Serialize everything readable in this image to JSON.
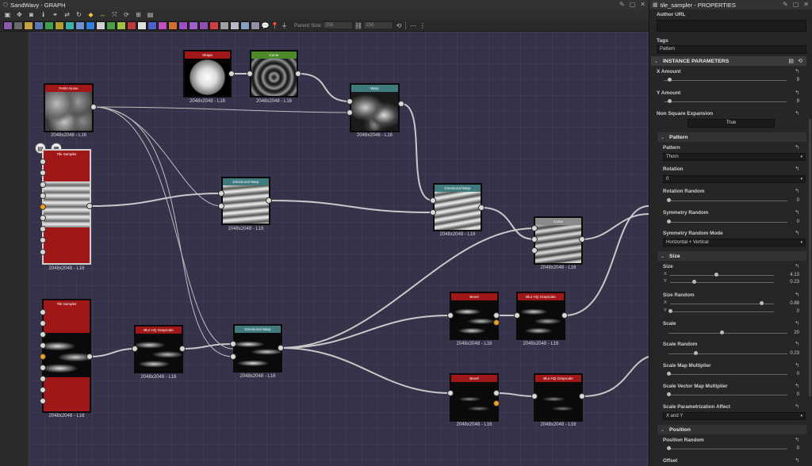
{
  "graph": {
    "title": "SandWavy - GRAPH",
    "parent_size_label": "Parent Size:",
    "parent_size_w": "256",
    "parent_size_h": "256",
    "toolbar1_icons": [
      "frame-icon",
      "fit-icon",
      "camera-icon",
      "info-icon",
      "link-icon",
      "swap-icon",
      "rotate-icon",
      "python-icon",
      "arrows-icon",
      "connect-icon",
      "refresh-icon",
      "graph-icon",
      "export-icon"
    ]
  },
  "nodes": {
    "shape": {
      "title": "Shape",
      "label": "2048x2048 - L16"
    },
    "curve": {
      "title": "Curve",
      "label": "2048x2048 - L16"
    },
    "warp": {
      "title": "Warp",
      "label": "2048x2048 - L16"
    },
    "perlin": {
      "title": "Perlin Noise",
      "label": "2048x2048 - L16"
    },
    "tile_sampler_1": {
      "title": "Tile Sampler",
      "label": "2048x2048 - L16"
    },
    "dir_warp_1": {
      "title": "Directional Warp",
      "label": "2048x2048 - L16"
    },
    "dir_warp_2": {
      "title": "Directional Warp",
      "label": "2048x2048 - L16"
    },
    "curve_2": {
      "title": "Curve",
      "label": "2048x2048 - L16"
    },
    "tile_sampler_2": {
      "title": "Tile Sampler",
      "label": "2048x2048 - L16"
    },
    "blur_1": {
      "title": "Blur HQ Grayscale",
      "label": "2048x2048 - L16"
    },
    "dir_warp_3": {
      "title": "Directional Warp",
      "label": "2048x2048 - L16"
    },
    "bevel_1": {
      "title": "Bevel",
      "label": "2048x2048 - L16"
    },
    "blur_2": {
      "title": "Blur HQ Grayscale",
      "label": "2048x2048 - L16"
    },
    "bevel_2": {
      "title": "Bevel",
      "label": "2048x2048 - L16"
    },
    "blur_3": {
      "title": "Blur HQ Grayscale",
      "label": "2048x2048 - L16"
    }
  },
  "props": {
    "title": "tile_sampler - PROPERTIES",
    "author_url_label": "Author URL",
    "author_url_value": "",
    "tags_label": "Tags",
    "tags_value": "Pattern",
    "instance_parameters": "INSTANCE PARAMETERS",
    "x_amount": {
      "label": "X Amount",
      "value": "9"
    },
    "y_amount": {
      "label": "Y Amount",
      "value": "9"
    },
    "non_square": {
      "label": "Non Square Expansion",
      "value": "True"
    },
    "pattern_section": "Pattern",
    "pattern": {
      "label": "Pattern",
      "value": "Thorn"
    },
    "rotation": {
      "label": "Rotation",
      "value": "0"
    },
    "rotation_random": {
      "label": "Rotation Random",
      "value": "0"
    },
    "symmetry_random": {
      "label": "Symmetry Random",
      "value": "0"
    },
    "symmetry_random_mode": {
      "label": "Symmetry Random Mode",
      "value": "Horizontal + Vertical"
    },
    "size_section": "Size",
    "size": {
      "label": "Size",
      "x_label": "X",
      "y_label": "Y",
      "x_value": "4.13",
      "y_value": "0.23"
    },
    "size_random": {
      "label": "Size Random",
      "x_label": "X",
      "y_label": "Y",
      "x_value": "0.88",
      "y_value": "0"
    },
    "scale": {
      "label": "Scale",
      "value": "20"
    },
    "scale_random": {
      "label": "Scale Random",
      "value": "0.23"
    },
    "scale_map_mult": {
      "label": "Scale Map Multiplier",
      "value": "0"
    },
    "scale_vector_mult": {
      "label": "Scale Vector Map Multiplier",
      "value": "0"
    },
    "scale_param_affect": {
      "label": "Scale Parametrization Affect",
      "value": "X and Y"
    },
    "position_section": "Position",
    "position_random": {
      "label": "Position Random",
      "value": "0"
    },
    "offset": {
      "label": "Offset",
      "value": ""
    }
  },
  "slider_levels": {
    "x_amount": 0.05,
    "y_amount": 0.05,
    "rotation_random": 0.0,
    "symmetry_random": 0.0,
    "size_x": 0.45,
    "size_y": 0.23,
    "size_random_x": 0.88,
    "size_random_y": 0.0,
    "scale": 0.45,
    "scale_random": 0.23,
    "scale_map": 0.0,
    "scale_vector": 0.0,
    "position_random": 0.0
  },
  "colors": {
    "canvas": "#36324a",
    "header_red": "#a11717",
    "header_green": "#4d8a2a",
    "header_teal": "#3f7a7f",
    "header_gray": "#8a8a8a",
    "port_orange": "#f0a020"
  }
}
